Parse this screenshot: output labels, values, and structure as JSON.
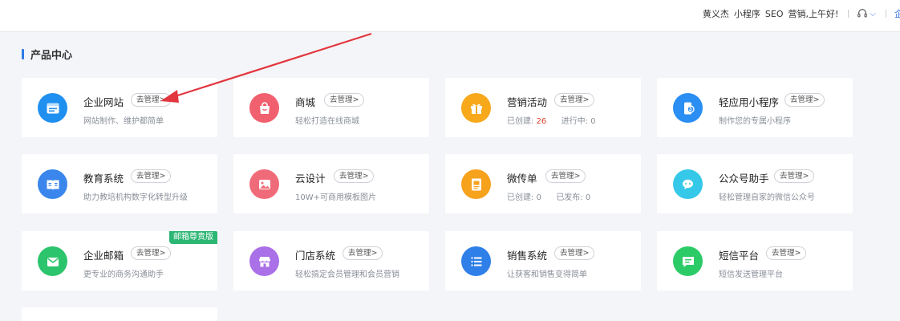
{
  "topbar": {
    "user": "黄义杰",
    "link_miniprogram": "小程序",
    "link_seo": "SEO",
    "greeting": "营销,上午好!",
    "cut_text": "企"
  },
  "section": {
    "title": "产品中心"
  },
  "manage_label": "去管理>",
  "colors": {
    "accent": "#2f7be5",
    "arrow": "#e2373f",
    "badge": "#2bb673"
  },
  "products": [
    {
      "name": "企业网站",
      "desc": "网站制作、维护都简单",
      "icon": "website-icon",
      "color": "#1f8ff0"
    },
    {
      "name": "商城",
      "desc": "轻松打造在线商城",
      "icon": "shopping-bag-icon",
      "color": "#f0606e"
    },
    {
      "name": "营销活动",
      "desc_created_label": "已创建:",
      "desc_created_value": "26",
      "desc_running_label": "进行中:",
      "desc_running_value": "0",
      "icon": "gift-icon",
      "color": "#f7a91b"
    },
    {
      "name": "轻应用小程序",
      "desc": "制作您的专属小程序",
      "icon": "miniprogram-icon",
      "color": "#2a8ef2"
    },
    {
      "name": "教育系统",
      "desc": "助力教培机构数字化转型升级",
      "icon": "book-icon",
      "color": "#3a86ec"
    },
    {
      "name": "云设计",
      "desc": "10W+可商用模板图片",
      "icon": "image-icon",
      "color": "#f06b79"
    },
    {
      "name": "微传单",
      "desc_created_label": "已创建:",
      "desc_created_value": "0",
      "desc_published_label": "已发布:",
      "desc_published_value": "0",
      "icon": "flyer-icon",
      "color": "#f6a21c"
    },
    {
      "name": "公众号助手",
      "desc": "轻松管理自家的微信公众号",
      "icon": "wechat-icon",
      "color": "#36c8e8"
    },
    {
      "name": "企业邮箱",
      "desc": "更专业的商务沟通助手",
      "icon": "mail-icon",
      "color": "#2cc46c",
      "badge": "邮箱尊贵版"
    },
    {
      "name": "门店系统",
      "desc": "轻松搞定会员管理和会员营销",
      "icon": "store-icon",
      "color": "#a970e8"
    },
    {
      "name": "销售系统",
      "desc": "让获客和销售变得简单",
      "icon": "list-icon",
      "color": "#2f7fe8"
    },
    {
      "name": "短信平台",
      "desc": "短信发送管理平台",
      "icon": "sms-icon",
      "color": "#2ccb67"
    }
  ]
}
